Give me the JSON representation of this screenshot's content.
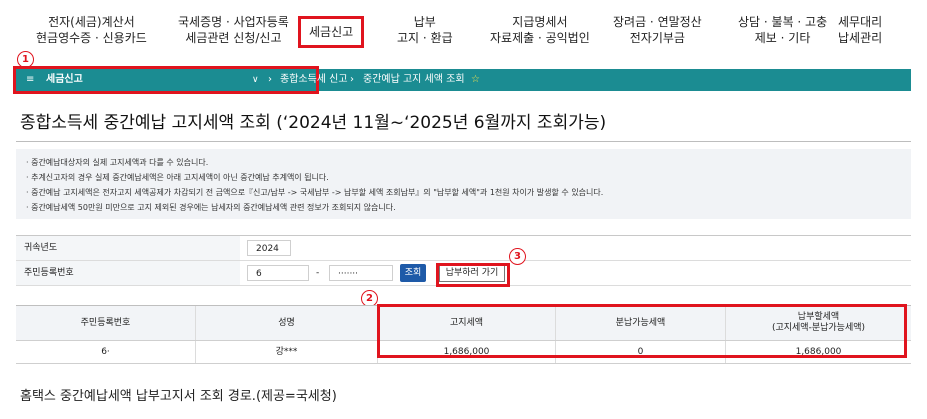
{
  "nav": [
    {
      "line1": "전자(세금)계산서",
      "line2": "현금영수증 · 신용카드"
    },
    {
      "line1": "국세증명 · 사업자등록",
      "line2": "세금관련 신청/신고"
    },
    {
      "line1": "세금신고",
      "line2": ""
    },
    {
      "line1": "납부",
      "line2": "고지 · 환급"
    },
    {
      "line1": "지급명세서",
      "line2": "자료제출 · 공익법인"
    },
    {
      "line1": "장려금 · 연말정산",
      "line2": "전자기부금"
    },
    {
      "line1": "상담 · 불복 · 고충",
      "line2": "제보 · 기타"
    },
    {
      "line1": "세무대리",
      "line2": "납세관리"
    }
  ],
  "markers": {
    "one": "1",
    "two": "2",
    "three": "3"
  },
  "breadcrumb": {
    "menu_icon": "≡",
    "section": "세금신고",
    "dropdown_icon": "∨",
    "sep_icon": "›",
    "item1": "종합소득세 신고",
    "item2": "중간예납 고지 세액 조회",
    "star_icon": "☆"
  },
  "page_title": "종합소득세 중간예납 고지세액 조회 (‘2024년 11월~‘2025년 6월까지 조회가능)",
  "notices": [
    "· 중간예납대상자의 실제 고지세액과 다를 수 있습니다.",
    "· 추계신고자의 경우 실제 중간예납세액은 아래 고지세액이 아닌 중간예납 추계액이 됩니다.",
    "· 중간예납 고지세액은 전자고지 세액공제가 차감되기 전 금액으로『신고/납부 -> 국세납부 -> 납부할 세액 조회납부』의 \"납부할 세액\"과 1천원 차이가 발생할 수 있습니다.",
    "· 중간예납세액 50만원 미만으로 고지 제외된 경우에는 납세자의 중간예납세액 관련 정보가 조회되지 않습니다."
  ],
  "form": {
    "year_label": "귀속년도",
    "year_value": "2024",
    "rrn_label": "주민등록번호",
    "rrn_front": "6",
    "rrn_dash": "-",
    "rrn_back": "·······",
    "search_button": "조회",
    "pay_button": "납부하러 가기"
  },
  "table": {
    "headers": [
      "주민등록번호",
      "성명",
      "고지세액",
      "분납가능세액",
      "납부할세액",
      "(고지세액-분납가능세액)"
    ],
    "row": [
      "6·",
      "강***",
      "1,686,000",
      "0",
      "1,686,000"
    ]
  },
  "caption": "홈택스 중간예납세액 납부고지서 조회 경로.(제공=국세청)",
  "colors": {
    "accent_red": "#e0141e",
    "bar_teal": "#1b8c92",
    "button_blue": "#1e5aa8"
  }
}
